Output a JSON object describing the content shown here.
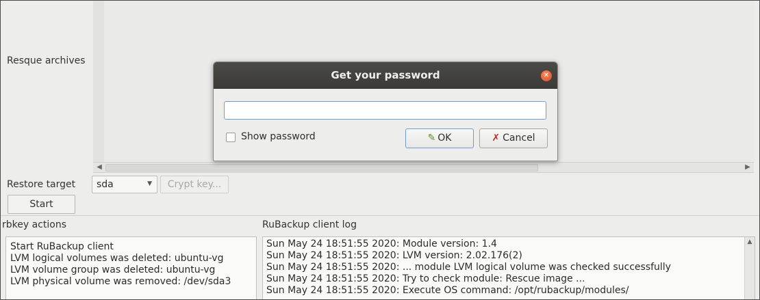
{
  "labels": {
    "resque_archives": "Resque archives",
    "restore_target": "Restore target",
    "rbkey_actions": "rbkey actions",
    "client_log": "RuBackup client log"
  },
  "restore": {
    "target_value": "sda",
    "crypt_key_label": "Crypt key...",
    "start_label": "Start"
  },
  "rbkey_actions": [
    "Start RuBackup client",
    "LVM logical volumes was deleted: ubuntu-vg",
    "LVM volume group was deleted: ubuntu-vg",
    "LVM physical volume was removed: /dev/sda3"
  ],
  "client_log": [
    "Sun May 24 18:51:55 2020: Module version: 1.4",
    "Sun May 24 18:51:55 2020: LVM version: 2.02.176(2)",
    "Sun May 24 18:51:55 2020: ... module LVM logical volume was checked successfully",
    "Sun May 24 18:51:55 2020: Try to check module: Rescue image ...",
    "Sun May 24 18:51:55 2020: Execute OS command: /opt/rubackup/modules/"
  ],
  "dialog": {
    "title": "Get your password",
    "password_value": "",
    "show_password_label": "Show password",
    "show_password_checked": false,
    "ok_label": "OK",
    "cancel_label": "Cancel"
  },
  "icons": {
    "close": "close-icon",
    "ok": "ok-pen-icon",
    "cancel": "cancel-x-icon"
  },
  "colors": {
    "titlebar": "#3f3e3b",
    "close_button": "#e8582a",
    "focus_border": "#6f9cd0",
    "cancel_icon": "#c8281c",
    "ok_icon": "#5f8a2e"
  }
}
